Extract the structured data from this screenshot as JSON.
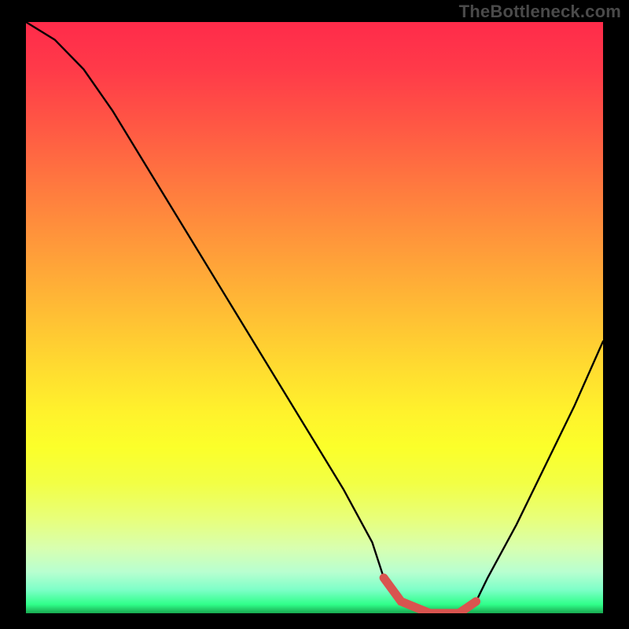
{
  "watermark": "TheBottleneck.com",
  "chart_data": {
    "type": "line",
    "title": "",
    "xlabel": "",
    "ylabel": "",
    "xlim": [
      0,
      100
    ],
    "ylim": [
      0,
      100
    ],
    "series": [
      {
        "name": "bottleneck-curve",
        "x": [
          0,
          5,
          10,
          15,
          20,
          25,
          30,
          35,
          40,
          45,
          50,
          55,
          60,
          62,
          65,
          70,
          75,
          78,
          80,
          85,
          90,
          95,
          100
        ],
        "values": [
          100,
          97,
          92,
          85,
          77,
          69,
          61,
          53,
          45,
          37,
          29,
          21,
          12,
          6,
          2,
          0,
          0,
          2,
          6,
          15,
          25,
          35,
          46
        ]
      }
    ],
    "highlight": {
      "name": "optimal-range",
      "color": "#d9544f",
      "x": [
        62,
        65,
        70,
        75,
        78
      ],
      "values": [
        6,
        2,
        0,
        0,
        2
      ]
    }
  },
  "colors": {
    "curve": "#000000",
    "highlight": "#d9544f",
    "frame": "#000000"
  }
}
